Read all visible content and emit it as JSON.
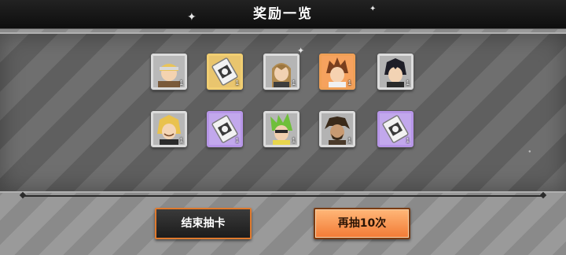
{
  "header": {
    "title": "奖励一览"
  },
  "rewards": {
    "row1": [
      {
        "type": "character",
        "rarity": "silver",
        "icon": "character-blonde-bandana-icon",
        "count": "1"
      },
      {
        "type": "item",
        "rarity": "gold",
        "icon": "ticket-item-icon",
        "count": "1"
      },
      {
        "type": "character",
        "rarity": "silver",
        "icon": "character-long-hair-icon",
        "count": "1"
      },
      {
        "type": "character",
        "rarity": "orange",
        "icon": "character-brown-spiky-icon",
        "count": "1"
      },
      {
        "type": "character",
        "rarity": "silver",
        "icon": "character-black-hair-icon",
        "count": "1"
      }
    ],
    "row2": [
      {
        "type": "character",
        "rarity": "silver",
        "icon": "character-blonde-smile-icon",
        "count": "1"
      },
      {
        "type": "item",
        "rarity": "purple",
        "icon": "ticket-item-icon",
        "count": "1"
      },
      {
        "type": "character",
        "rarity": "silver",
        "icon": "character-green-hair-icon",
        "count": "1"
      },
      {
        "type": "character",
        "rarity": "silver",
        "icon": "character-dark-bearded-icon",
        "count": "1"
      },
      {
        "type": "item",
        "rarity": "purple",
        "icon": "ticket-item-icon",
        "count": "1"
      }
    ]
  },
  "actions": {
    "end_label": "结束抽卡",
    "again_label": "再抽10次"
  },
  "colors": {
    "accent_orange": "#f27a35",
    "rarity_gold": "#f2cf72",
    "rarity_purple": "#b796e8",
    "rarity_silver": "#dcdcdc",
    "rarity_orange": "#f0a056"
  }
}
